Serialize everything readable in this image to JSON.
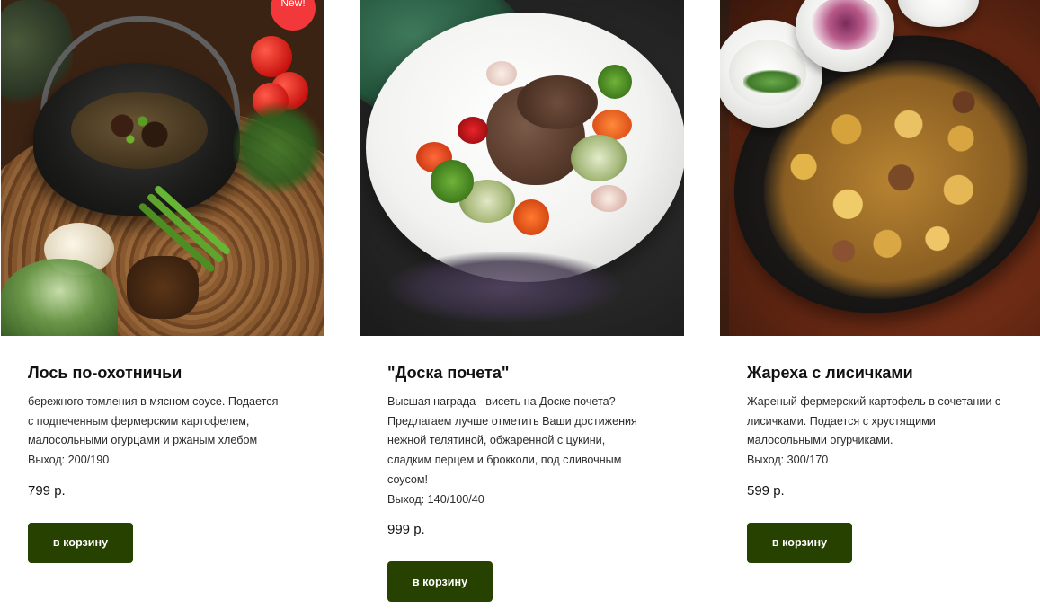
{
  "badge": {
    "new_label": "New!"
  },
  "colors": {
    "button_bg": "#264100",
    "badge_bg": "#f2383a",
    "text": "#111111"
  },
  "products": [
    {
      "title": "Лось по-охотничьи",
      "description": "бережного томления в мясном соусе. Подается\nс подпеченным фермерским картофелем,\nмалосольными огурцами и ржаным хлебом",
      "yield": "Выход: 200/190",
      "price": "799 р.",
      "button_label": "в корзину",
      "is_new": true
    },
    {
      "title": "\"Доска почета\"",
      "description": "Высшая награда - висеть на Доске почета?\nПредлагаем лучше отметить Ваши достижения\nнежной телятиной, обжаренной с цукини,\nсладким перцем и брокколи, под сливочным\nсоусом!",
      "yield": "Выход: 140/100/40",
      "price": "999 р.",
      "button_label": "в корзину",
      "is_new": false
    },
    {
      "title": "Жареха с лисичками",
      "description": "Жареный фермерский картофель в сочетании с\nлисичками. Подается с хрустящими\nмалосольными огурчиками.",
      "yield": "Выход: 300/170",
      "price": "599 р.",
      "button_label": "в корзину",
      "is_new": false
    }
  ]
}
